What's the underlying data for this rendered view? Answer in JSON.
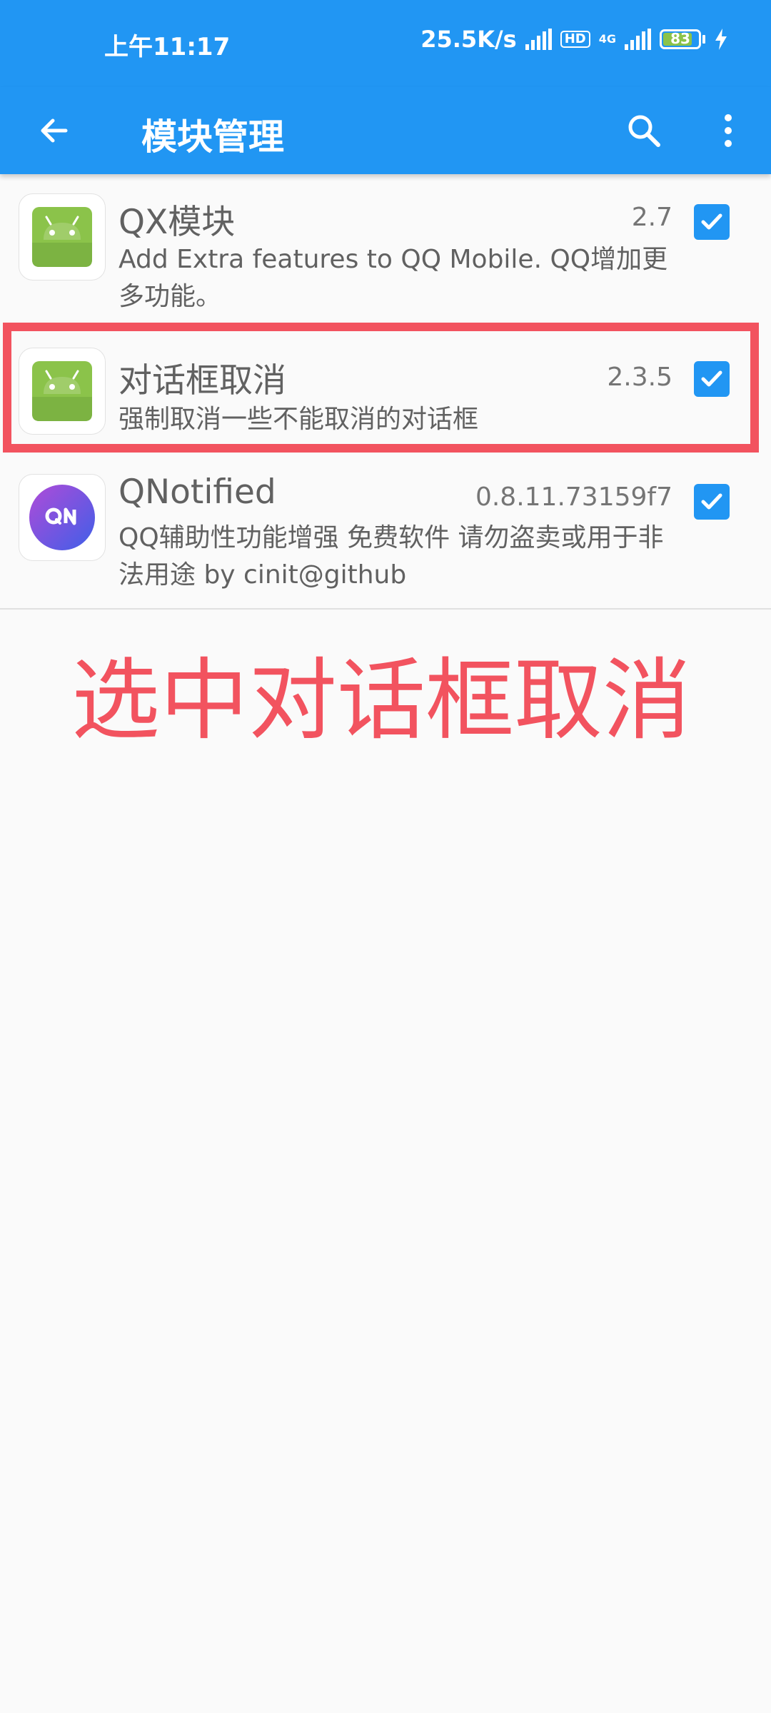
{
  "status_bar": {
    "time": "上午11:17",
    "net_speed": "25.5K/s",
    "hd": "HD",
    "net_type": "4G",
    "battery_level": "83",
    "battery_fraction": 0.83,
    "icons": [
      "signal-icon",
      "hd-icon",
      "signal-4g-icon",
      "battery-icon",
      "charging-icon"
    ]
  },
  "app_bar": {
    "title": "模块管理",
    "back_icon": "arrow-left-icon",
    "search_icon": "search-icon",
    "more_icon": "more-vertical-icon"
  },
  "modules": [
    {
      "name": "QX模块",
      "version": "2.7",
      "description": "Add Extra features to QQ Mobile. QQ增加更多功能。",
      "icon": "android-icon",
      "checked": true
    },
    {
      "name": "对话框取消",
      "version": "2.3.5",
      "description": "强制取消一些不能取消的对话框",
      "icon": "android-icon",
      "checked": true
    },
    {
      "name": "QNotified",
      "version": "0.8.11.73159f7",
      "description": "QQ辅助性功能增强 免费软件 请勿盗卖或用于非法用途 by cinit@github",
      "icon": "qnotified-icon",
      "checked": true
    }
  ],
  "annotation": {
    "text": "选中对话框取消"
  },
  "colors": {
    "primary": "#2196f3",
    "highlight": "#f2535f",
    "android_green": "#8bc34a",
    "battery_green": "#8bc34a",
    "background": "#fafafa"
  }
}
